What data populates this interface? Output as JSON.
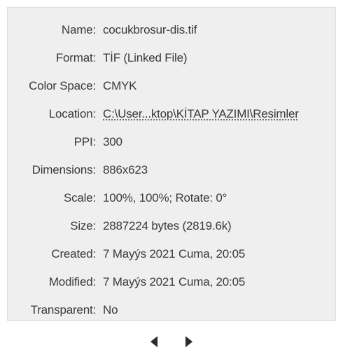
{
  "fields": [
    {
      "label": "Name:",
      "value": "cocukbrosur-dis.tif"
    },
    {
      "label": "Format:",
      "value": "TİF (Linked File)"
    },
    {
      "label": "Color Space:",
      "value": "CMYK"
    },
    {
      "label": "Location:",
      "value": "C:\\User...ktop\\KİTAP YAZIMI\\Resimler"
    },
    {
      "label": "PPI:",
      "value": "300"
    },
    {
      "label": "Dimensions:",
      "value": "886x623"
    },
    {
      "label": "Scale:",
      "value": "100%, 100%; Rotate: 0°"
    },
    {
      "label": "Size:",
      "value": "2887224 bytes (2819.6k)"
    },
    {
      "label": "Created:",
      "value": "7 Mayýs 2021 Cuma, 20:05"
    },
    {
      "label": "Modified:",
      "value": "7 Mayýs 2021 Cuma, 20:05"
    },
    {
      "label": "Transparent:",
      "value": "No"
    }
  ],
  "nav": {
    "prev_icon": "triangle-left-icon",
    "next_icon": "triangle-right-icon"
  },
  "colors": {
    "panel_bg": "#efefef",
    "text": "#3a3a3a",
    "arrow": "#2b2b2b"
  }
}
